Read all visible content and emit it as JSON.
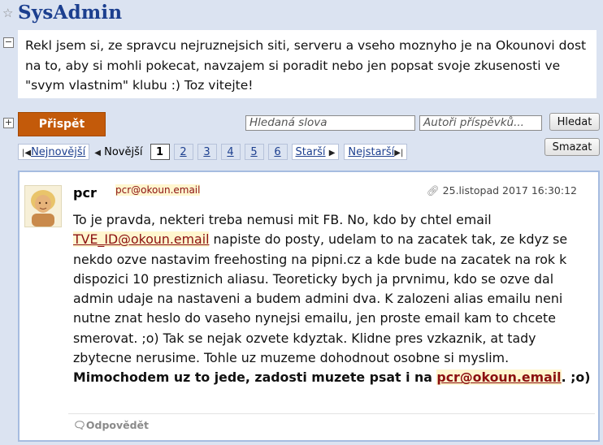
{
  "header": {
    "title": "SysAdmin",
    "star_icon": "star-icon"
  },
  "description": "Rekl jsem si, ze spravcu nejruznejsich siti, serveru a vseho moznyho je na Okounovi dost na to, aby si mohli pokecat, navzajem si poradit nebo jen popsat svoje zkusenosti ve \"svym vlastnim\" klubu :) Toz vitejte!",
  "toolbar": {
    "collapse_minus": "−",
    "expand_plus": "+",
    "prispet_label": "Přispět",
    "search_placeholder": "Hledaná slova",
    "authors_placeholder": "Autoři příspěvků...",
    "search_button": "Hledat",
    "delete_button": "Smazat"
  },
  "pager": {
    "newest": "Nejnovější",
    "newer": "Novější",
    "pages": [
      "1",
      "2",
      "3",
      "4",
      "5",
      "6"
    ],
    "current_page": "1",
    "older": "Starší",
    "oldest": "Nejstarší"
  },
  "post": {
    "author": "pcr",
    "author_email": "pcr@okoun.email",
    "date": "25.listopad 2017 16:30:12",
    "body_part1": "To je pravda, nekteri treba nemusi mit FB. No, kdo by chtel email",
    "body_email": "TVE_ID@okoun.email",
    "body_part2": " napiste do posty, udelam to na zacatek tak, ze kdyz se nekdo ozve nastavim freehosting na pipni.cz a kde bude na zacatek na rok k dispozici 10 prestiznich aliasu. Teoreticky bych ja prvnimu, kdo se ozve dal admin udaje na nastaveni a budem admini dva. K zalozeni alias emailu neni nutne znat heslo do vaseho nynejsi emailu, jen proste email kam to chcete smerovat. ;o) Tak se nejak ozvete kdyztak. Klidne pres vzkaznik, at tady zbytecne nerusime. Tohle uz muzeme dohodnout osobne si myslim.",
    "bold_text": "Mimochodem uz to jede, zadosti muzete psat i na ",
    "bold_email": "pcr@okoun.email",
    "bold_end": ". ;o)",
    "reply_label": "Odpovědět"
  }
}
